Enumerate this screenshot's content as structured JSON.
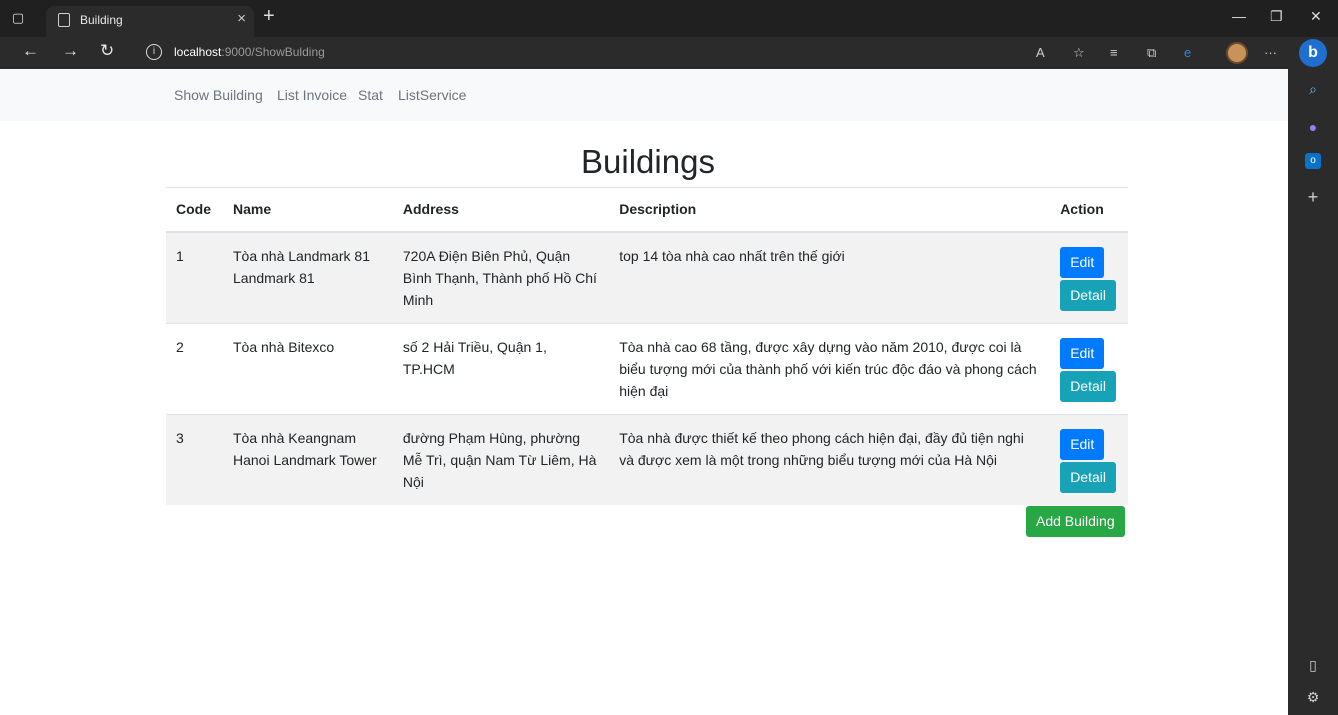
{
  "browser": {
    "tab_title": "Building",
    "url_host": "localhost",
    "url_path": ":9000/ShowBulding"
  },
  "navbar": {
    "links": [
      "Show Building",
      "List Invoice",
      "Stat",
      "ListService"
    ]
  },
  "page_title": "Buildings",
  "table": {
    "headers": [
      "Code",
      "Name",
      "Address",
      "Description",
      "Action"
    ],
    "rows": [
      {
        "code": "1",
        "name": "Tòa nhà Landmark 81 Landmark 81",
        "address": "720A Điện Biên Phủ, Quận Bình Thạnh, Thành phố Hồ Chí Minh",
        "description": "top 14 tòa nhà cao nhất trên thế giới"
      },
      {
        "code": "2",
        "name": "Tòa nhà Bitexco",
        "address": "số 2 Hải Triều, Quận 1, TP.HCM",
        "description": "Tòa nhà cao 68 tầng, được xây dựng vào năm 2010, được coi là biểu tượng mới của thành phố với kiến trúc độc đáo và phong cách hiện đại"
      },
      {
        "code": "3",
        "name": "Tòa nhà Keangnam Hanoi Landmark Tower",
        "address": "đường Phạm Hùng, phường Mễ Trì, quận Nam Từ Liêm, Hà Nội",
        "description": "Tòa nhà được thiết kế theo phong cách hiện đại, đầy đủ tiện nghi và được xem là một trong những biểu tượng mới của Hà Nội"
      }
    ],
    "edit_label": "Edit",
    "detail_label": "Detail"
  },
  "add_button_label": "Add Building",
  "colors": {
    "edit": "#007bff",
    "detail": "#17a2b8",
    "add": "#28a745"
  }
}
